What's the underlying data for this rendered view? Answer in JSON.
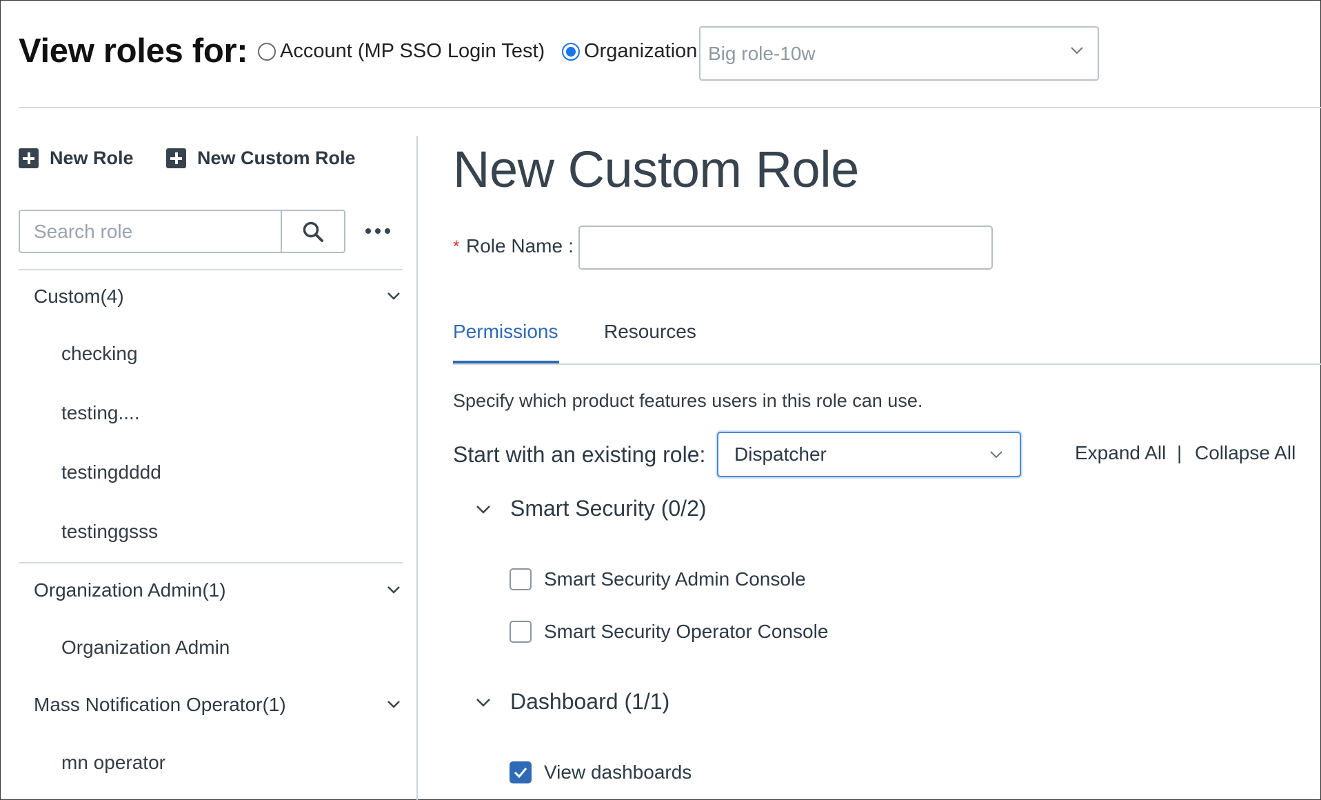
{
  "header": {
    "title": "View roles for:",
    "scope_options": [
      {
        "label": "Account (MP SSO Login Test)",
        "selected": false
      },
      {
        "label": "Organization",
        "selected": true
      }
    ],
    "organization_select": {
      "value": "Big role-10w"
    }
  },
  "sidebar": {
    "toolbar": {
      "new_role": "New Role",
      "new_custom_role": "New Custom Role"
    },
    "search": {
      "placeholder": "Search role",
      "value": ""
    },
    "groups": [
      {
        "label": "Custom(4)",
        "items": [
          "checking",
          "testing....",
          "testingdddd",
          "testinggsss"
        ]
      },
      {
        "label": "Organization Admin(1)",
        "items": [
          "Organization Admin"
        ]
      },
      {
        "label": "Mass Notification Operator(1)",
        "items": [
          "mn operator"
        ]
      }
    ]
  },
  "main": {
    "title": "New Custom Role",
    "role_name": {
      "required_mark": "*",
      "label": "Role Name",
      "separator": ":",
      "value": ""
    },
    "tabs": [
      {
        "label": "Permissions",
        "active": true
      },
      {
        "label": "Resources",
        "active": false
      }
    ],
    "permissions": {
      "description": "Specify which product features users in this role can use.",
      "start_with_label": "Start with an existing role:",
      "start_with_value": "Dispatcher",
      "expand_all": "Expand All",
      "separator": "|",
      "collapse_all": "Collapse All",
      "sections": [
        {
          "label": "Smart Security (0/2)",
          "items": [
            {
              "label": "Smart Security Admin Console",
              "checked": false
            },
            {
              "label": "Smart Security Operator Console",
              "checked": false
            }
          ]
        },
        {
          "label": "Dashboard (1/1)",
          "items": [
            {
              "label": "View dashboards",
              "checked": true
            }
          ]
        }
      ]
    }
  },
  "colors": {
    "accent": "#2e6ab5",
    "radio_accent": "#1a73e8",
    "required": "#d32f2f",
    "text": "#2d3a45"
  }
}
